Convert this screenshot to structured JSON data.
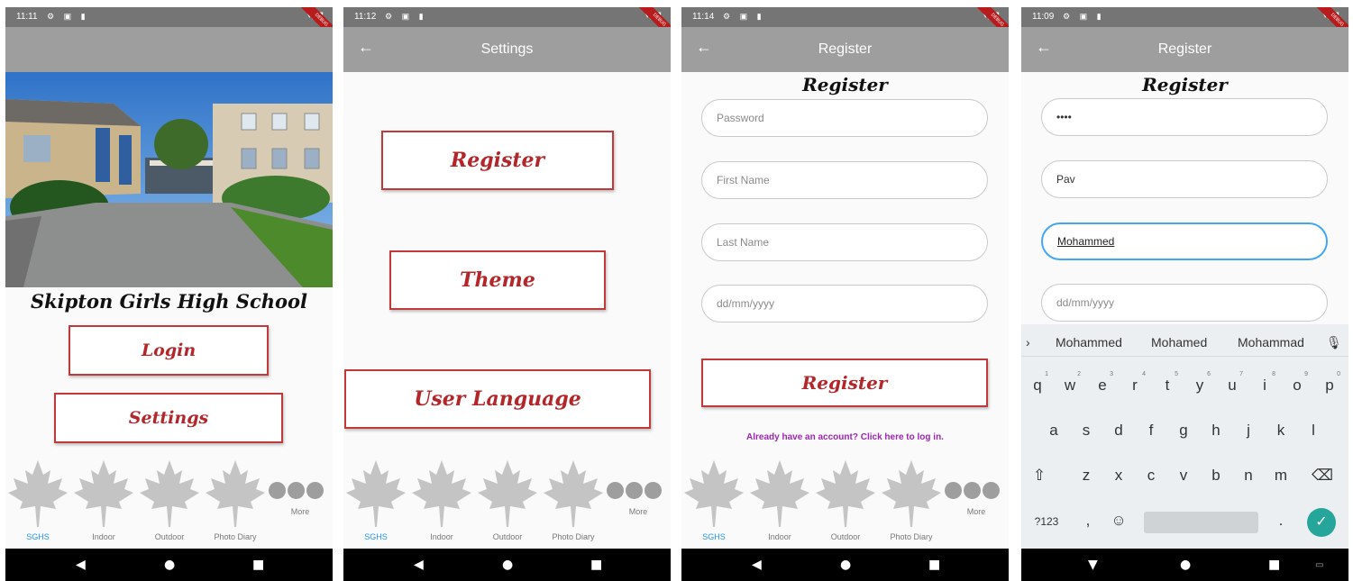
{
  "status": {
    "p1_time": "11:11",
    "p2_time": "11:12",
    "p3_time": "11:14",
    "p4_time": "11:09",
    "icons": "⚙ ▣ ▮",
    "signal": "▾◢▮",
    "debug_ribbon": "DEBUG"
  },
  "screen_home": {
    "school_name": "Skipton Girls High School",
    "login_label": "Login",
    "settings_label": "Settings"
  },
  "screen_settings": {
    "title": "Settings",
    "back": "←",
    "register_label": "Register",
    "theme_label": "Theme",
    "language_label": "User Language"
  },
  "screen_register": {
    "title": "Register",
    "back": "←",
    "heading": "Register",
    "password_placeholder": "Password",
    "firstname_placeholder": "First Name",
    "lastname_placeholder": "Last Name",
    "dob_placeholder": "dd/mm/yyyy",
    "register_button": "Register",
    "login_link": "Already have an account? Click here to log in."
  },
  "screen_register_filled": {
    "title": "Register",
    "back": "←",
    "heading": "Register",
    "password_value": "••••",
    "firstname_value": "Pav",
    "lastname_value": "Mohammed",
    "dob_placeholder": "dd/mm/yyyy"
  },
  "bottom_nav": {
    "items": [
      "SGHS",
      "Indoor",
      "Outdoor",
      "Photo Diary"
    ],
    "more": "More"
  },
  "system_nav": {
    "back": "◀",
    "home": "●",
    "recents": "■",
    "down": "▼",
    "kb": "▭"
  },
  "keyboard": {
    "expand": "›",
    "suggestions": [
      "Mohammed",
      "Mohamed",
      "Mohammad"
    ],
    "mic": "🎙",
    "row1": [
      "q",
      "w",
      "e",
      "r",
      "t",
      "y",
      "u",
      "i",
      "o",
      "p"
    ],
    "row1_nums": [
      "1",
      "2",
      "3",
      "4",
      "5",
      "6",
      "7",
      "8",
      "9",
      "0"
    ],
    "row2": [
      "a",
      "s",
      "d",
      "f",
      "g",
      "h",
      "j",
      "k",
      "l"
    ],
    "row3": [
      "z",
      "x",
      "c",
      "v",
      "b",
      "n",
      "m"
    ],
    "shift": "⇧",
    "backspace": "⌫",
    "symbols": "?123",
    "comma": ",",
    "emoji": "☺",
    "period": ".",
    "done": "✓"
  },
  "colors": {
    "appbar": "#9e9e9e",
    "button_border": "#c0393b",
    "link": "#9c27b0",
    "active_nav": "#2196f3",
    "focus": "#42a5f5"
  }
}
